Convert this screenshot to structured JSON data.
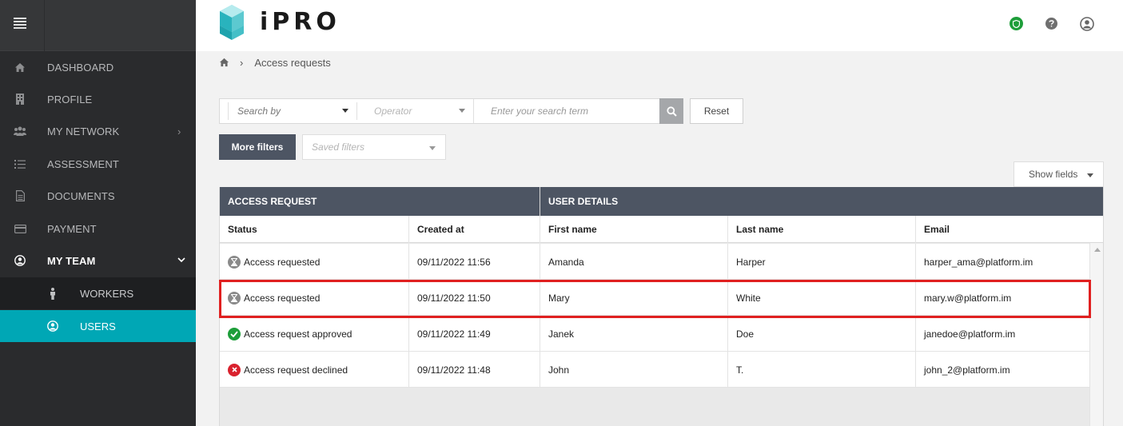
{
  "app": {
    "logo_text": "iPRO"
  },
  "sidebar": {
    "items": [
      {
        "label": "DASHBOARD",
        "icon": "home-icon"
      },
      {
        "label": "PROFILE",
        "icon": "building-icon"
      },
      {
        "label": "MY NETWORK",
        "icon": "users-icon",
        "expand": "›"
      },
      {
        "label": "ASSESSMENT",
        "icon": "list-icon"
      },
      {
        "label": "DOCUMENTS",
        "icon": "document-icon"
      },
      {
        "label": "PAYMENT",
        "icon": "credit-card-icon"
      },
      {
        "label": "MY TEAM",
        "icon": "user-circle-icon",
        "expand": "⌄",
        "active": true
      }
    ],
    "sub_items": [
      {
        "label": "WORKERS",
        "icon": "person-icon"
      },
      {
        "label": "USERS",
        "icon": "user-circle-icon",
        "selected": true
      }
    ]
  },
  "breadcrumb": {
    "current": "Access requests",
    "separator": "›"
  },
  "filters": {
    "search_by": "Search by",
    "operator": "Operator",
    "term_placeholder": "Enter your search term",
    "reset_label": "Reset",
    "more_filters_label": "More filters",
    "saved_filters": "Saved filters",
    "show_fields_label": "Show fields"
  },
  "table": {
    "groups": [
      "ACCESS REQUEST",
      "USER DETAILS"
    ],
    "columns": [
      "Status",
      "Created at",
      "First name",
      "Last name",
      "Email"
    ],
    "rows": [
      {
        "status": "Access requested",
        "status_type": "pending",
        "created_at": "09/11/2022 11:56",
        "first_name": "Amanda",
        "last_name": "Harper",
        "email": "harper_ama@platform.im"
      },
      {
        "status": "Access requested",
        "status_type": "pending",
        "created_at": "09/11/2022 11:50",
        "first_name": "Mary",
        "last_name": "White",
        "email": "mary.w@platform.im"
      },
      {
        "status": "Access request approved",
        "status_type": "approved",
        "created_at": "09/11/2022 11:49",
        "first_name": "Janek",
        "last_name": "Doe",
        "email": "janedoe@platform.im"
      },
      {
        "status": "Access request declined",
        "status_type": "declined",
        "created_at": "09/11/2022 11:48",
        "first_name": "John",
        "last_name": "T.",
        "email": "john_2@platform.im"
      }
    ]
  },
  "colors": {
    "sidebar_bg": "#2a2b2d",
    "accent_teal": "#00a7b5",
    "header_dark": "#4d5563",
    "approved_green": "#1e9e3a",
    "declined_red": "#d9222e",
    "pending_gray": "#8a8a8a",
    "highlight_red": "#e02020"
  }
}
